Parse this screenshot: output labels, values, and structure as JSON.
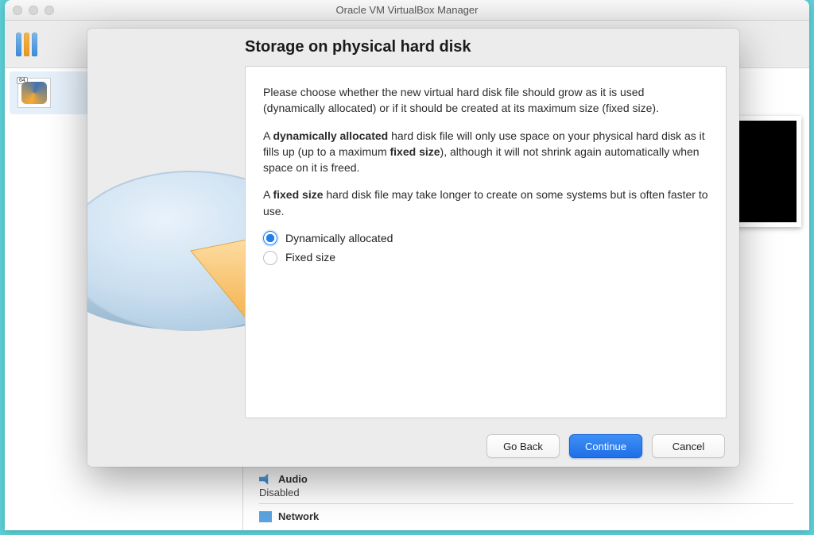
{
  "window": {
    "title": "Oracle VM VirtualBox Manager"
  },
  "sidebar": {
    "vm_badge": "64"
  },
  "details": {
    "audio_header": "Audio",
    "audio_status": "Disabled",
    "network_header": "Network"
  },
  "dialog": {
    "title": "Storage on physical hard disk",
    "para1": "Please choose whether the new virtual hard disk file should grow as it is used (dynamically allocated) or if it should be created at its maximum size (fixed size).",
    "para2_pre": "A ",
    "para2_b1": "dynamically allocated",
    "para2_mid": " hard disk file will only use space on your physical hard disk as it fills up (up to a maximum ",
    "para2_b2": "fixed size",
    "para2_post": "), although it will not shrink again automatically when space on it is freed.",
    "para3_pre": "A ",
    "para3_b1": "fixed size",
    "para3_post": " hard disk file may take longer to create on some systems but is often faster to use.",
    "option_dynamic": "Dynamically allocated",
    "option_fixed": "Fixed size",
    "buttons": {
      "back": "Go Back",
      "continue": "Continue",
      "cancel": "Cancel"
    }
  }
}
